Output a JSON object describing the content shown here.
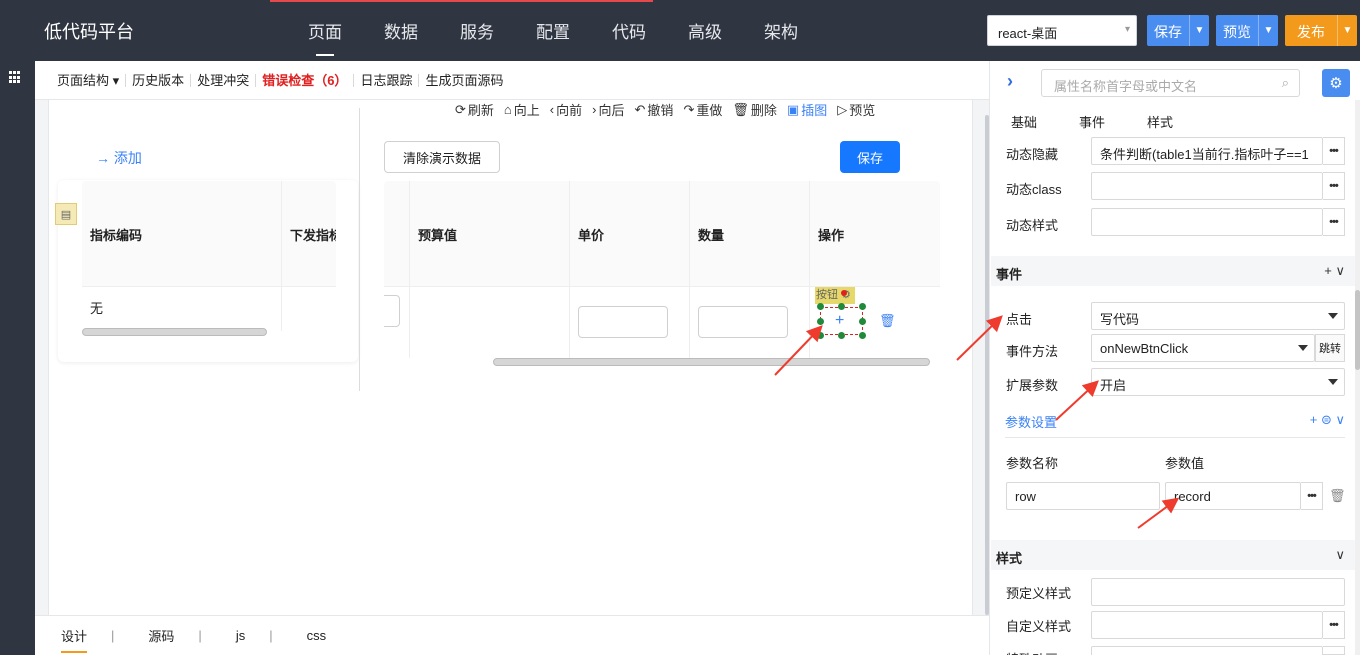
{
  "app": {
    "brand": "低代码平台"
  },
  "nav": [
    {
      "label": "页面",
      "active": true
    },
    {
      "label": "数据"
    },
    {
      "label": "服务"
    },
    {
      "label": "配置"
    },
    {
      "label": "代码"
    },
    {
      "label": "高级"
    },
    {
      "label": "架构"
    }
  ],
  "header": {
    "env_value": "react-桌面",
    "save_label": "保存",
    "preview_label": "预览",
    "publish_label": "发布",
    "colors": {
      "bar": "#2f3541",
      "primary": "#4a8df0",
      "publish": "#f39a1c"
    }
  },
  "toolbar": {
    "items": [
      "页面结构",
      "历史版本",
      "处理冲突",
      "错误检查（6）",
      "日志跟踪",
      "生成页面源码"
    ]
  },
  "actions": [
    {
      "icon": "refresh-icon",
      "glyph": "⟳",
      "label": "刷新"
    },
    {
      "icon": "up-icon",
      "glyph": "⌂",
      "label": "向上"
    },
    {
      "icon": "prev-icon",
      "glyph": "‹",
      "label": "向前"
    },
    {
      "icon": "next-icon",
      "glyph": "›",
      "label": "向后"
    },
    {
      "icon": "undo-icon",
      "glyph": "↶",
      "label": "撤销"
    },
    {
      "icon": "redo-icon",
      "glyph": "↷",
      "label": "重做"
    },
    {
      "icon": "delete-icon",
      "glyph": "🗑",
      "label": "删除"
    },
    {
      "icon": "image-icon",
      "glyph": "▣",
      "label": "插图",
      "active": true
    },
    {
      "icon": "preview-icon",
      "glyph": "▷",
      "label": "预览"
    }
  ],
  "canvas": {
    "add_label": "添加",
    "left_table": {
      "col1": "指标编码",
      "col2": "下发指标",
      "cell1": "无"
    },
    "clear_label": "清除演示数据",
    "save_label": "保存",
    "right_table": {
      "cols": [
        "预算值",
        "单价",
        "数量",
        "操作"
      ]
    },
    "button_tag": "按钮"
  },
  "bottom_tabs": [
    "设计",
    "源码",
    "js",
    "css"
  ],
  "panel": {
    "search_placeholder": "属性名称首字母或中文名",
    "tabs": [
      "基础",
      "事件",
      "样式"
    ],
    "dyn_hide_label": "动态隐藏",
    "dyn_hide_value": "条件判断(table1当前行.指标叶子==1",
    "dyn_class_label": "动态class",
    "dyn_style_label": "动态样式",
    "events_header": "事件",
    "events_header_icons": "+ ∨",
    "click_label": "点击",
    "click_value": "写代码",
    "method_label": "事件方法",
    "method_value": "onNewBtnClick",
    "jump_label": "跳转",
    "ext_label": "扩展参数",
    "ext_value": "开启",
    "param_header": "参数设置",
    "param_header_icons": "+ ⊜ ∨",
    "param_name_col": "参数名称",
    "param_value_col": "参数值",
    "param_name": "row",
    "param_value": "record",
    "style_header": "样式",
    "predef_label": "预定义样式",
    "custom_label": "自定义样式",
    "anim_label": "特殊动画"
  }
}
